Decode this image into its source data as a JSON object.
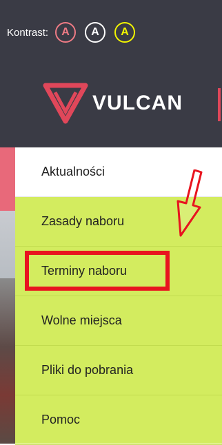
{
  "contrast": {
    "label": "Kontrast:",
    "buttons": [
      {
        "letter": "A",
        "color": "#ef7b85"
      },
      {
        "letter": "A",
        "color": "#ffffff"
      },
      {
        "letter": "A",
        "color": "#f2f500"
      }
    ]
  },
  "brand": {
    "name": "VULCAN",
    "logo_color": "#e0475a"
  },
  "menu": {
    "items": [
      {
        "label": "Aktualności",
        "state": "active"
      },
      {
        "label": "Zasady naboru",
        "state": "normal"
      },
      {
        "label": "Terminy naboru",
        "state": "highlighted"
      },
      {
        "label": "Wolne miejsca",
        "state": "normal"
      },
      {
        "label": "Pliki do pobrania",
        "state": "normal"
      },
      {
        "label": "Pomoc",
        "state": "normal"
      }
    ]
  },
  "colors": {
    "header_bg": "#3a3b45",
    "menu_bg": "#d3ec5f",
    "highlight_box": "#e8141f",
    "arrow": "#e8141f"
  }
}
